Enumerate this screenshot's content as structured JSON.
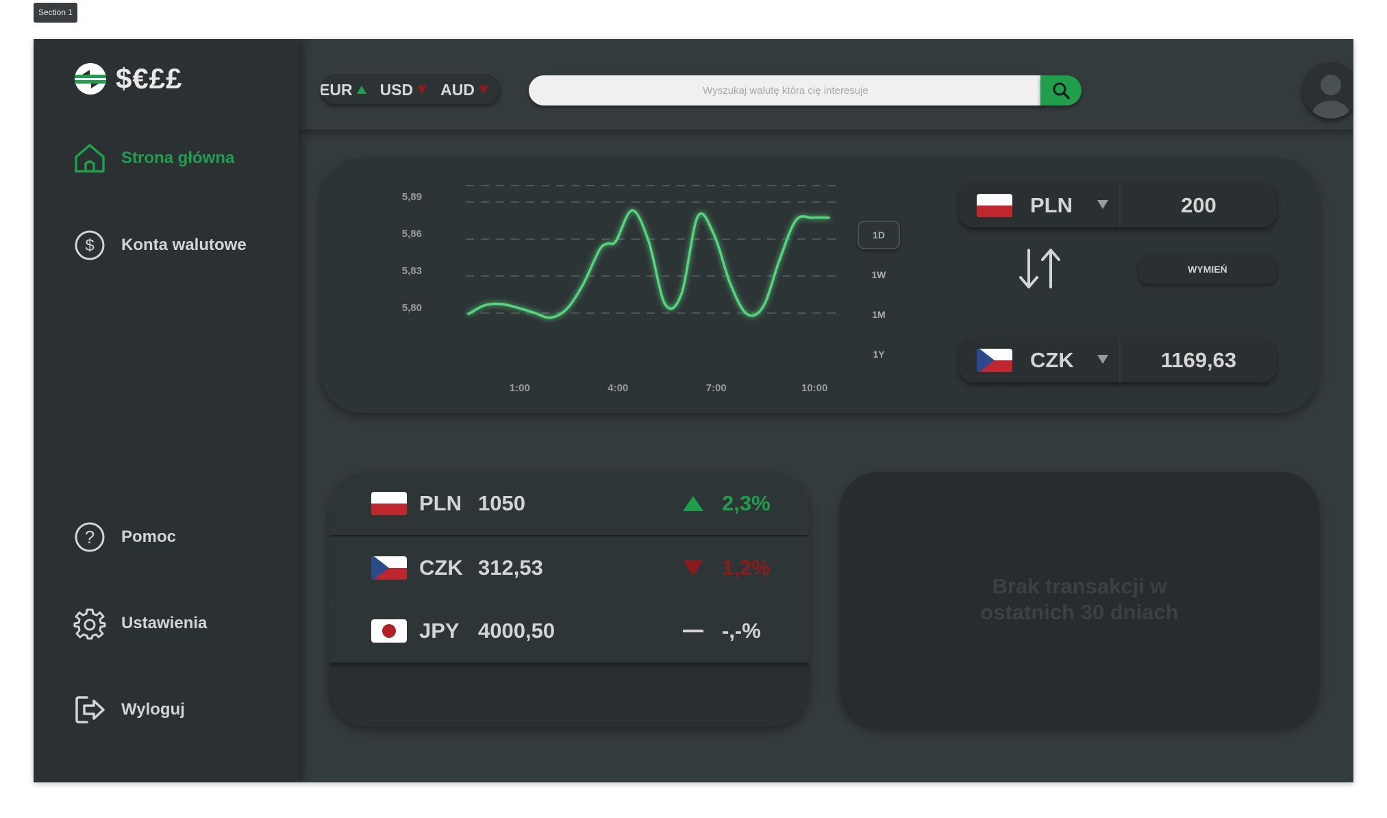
{
  "section_tag": "Section 1",
  "colors": {
    "accent": "#1f9e4c",
    "negative": "#8e1b1b",
    "sidebar": "#2b3133",
    "background": "#343b3d"
  },
  "logo": {
    "text": "$€££",
    "icon": "exchange-logo-icon"
  },
  "nav": {
    "home": "Strona główna",
    "accounts": "Konta walutowe",
    "help": "Pomoc",
    "settings": "Ustawienia",
    "logout": "Wyloguj"
  },
  "ticker": [
    {
      "code": "EUR",
      "trend": "up"
    },
    {
      "code": "USD",
      "trend": "down"
    },
    {
      "code": "AUD",
      "trend": "down"
    }
  ],
  "search": {
    "placeholder": "Wyszukaj walutę która cię interesuje",
    "icon": "search-icon"
  },
  "avatar": {
    "icon": "user-icon"
  },
  "chart_data": {
    "type": "line",
    "x": [
      "0:00",
      "0:30",
      "1:00",
      "1:30",
      "2:00",
      "2:30",
      "3:00",
      "3:30",
      "4:00",
      "4:15",
      "4:30",
      "5:00",
      "5:30",
      "6:00",
      "6:30",
      "7:00",
      "7:30",
      "8:00",
      "8:30",
      "9:00",
      "9:30",
      "10:00",
      "10:30",
      "11:00"
    ],
    "y": [
      5.796,
      5.803,
      5.804,
      5.801,
      5.797,
      5.793,
      5.8,
      5.82,
      5.848,
      5.853,
      5.855,
      5.88,
      5.855,
      5.804,
      5.812,
      5.875,
      5.86,
      5.82,
      5.796,
      5.802,
      5.84,
      5.872,
      5.874,
      5.874
    ],
    "xticks": [
      "1:00",
      "4:00",
      "7:00",
      "10:00"
    ],
    "yticks": [
      "5,89",
      "5,86",
      "5,83",
      "5,80"
    ],
    "ylim": [
      5.79,
      5.9
    ],
    "grid": true,
    "periods": [
      "1D",
      "1W",
      "1M",
      "1Y"
    ],
    "active_period": "1D",
    "line_color": "#54d67e"
  },
  "converter": {
    "from": {
      "code": "PLN",
      "amount": "200",
      "flag": "poland-flag-icon"
    },
    "to": {
      "code": "CZK",
      "amount": "1169,63",
      "flag": "czech-flag-icon"
    },
    "exchange_label": "WYMIEŃ",
    "swap_icon": "swap-arrows-icon"
  },
  "balances": [
    {
      "code": "PLN",
      "amount": "1050",
      "change": "2,3%",
      "trend": "up",
      "color": "#1f9e4c",
      "flag": "poland-flag-icon"
    },
    {
      "code": "CZK",
      "amount": "312,53",
      "change": "1,2%",
      "trend": "down",
      "color": "#8e1b1b",
      "flag": "czech-flag-icon"
    },
    {
      "code": "JPY",
      "amount": "4000,50",
      "change": "-,-%",
      "trend": "flat",
      "color": "#d4d4d4",
      "flag": "japan-flag-icon"
    }
  ],
  "transactions": {
    "empty_message": "Brak transakcji w ostatnich 30 dniach"
  }
}
